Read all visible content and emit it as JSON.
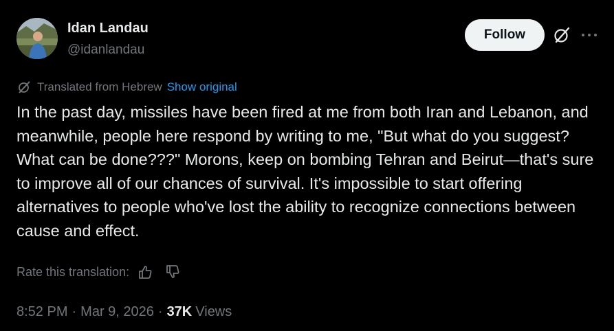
{
  "author": {
    "name": "Idan Landau",
    "handle": "@idanlandau"
  },
  "actions": {
    "follow_label": "Follow"
  },
  "translation": {
    "label": "Translated from Hebrew",
    "show_original": "Show original"
  },
  "post": {
    "text": "In the past day, missiles have been fired at me from both Iran and Lebanon, and meanwhile, people here respond by writing to me, \"But what do you suggest? What can be done???\" Morons, keep on bombing Tehran and Beirut—that's sure to improve all of our chances of survival. It's impossible to start offering alternatives to people who've lost the ability to recognize connections between cause and effect."
  },
  "rating": {
    "label": "Rate this translation:"
  },
  "meta": {
    "time": "8:52 PM",
    "separator": "·",
    "date": "Mar 9, 2026",
    "views_count": "37K",
    "views_label": "Views"
  },
  "icons": {
    "grok": "grok-icon",
    "more": "more-icon",
    "translate": "translate-icon",
    "thumbs_up": "thumbs-up-icon",
    "thumbs_down": "thumbs-down-icon"
  },
  "colors": {
    "background": "#000000",
    "text_primary": "#e7e9ea",
    "text_secondary": "#71767b",
    "link": "#1d9bf0",
    "follow_bg": "#eff3f4",
    "follow_text": "#0f1419"
  }
}
